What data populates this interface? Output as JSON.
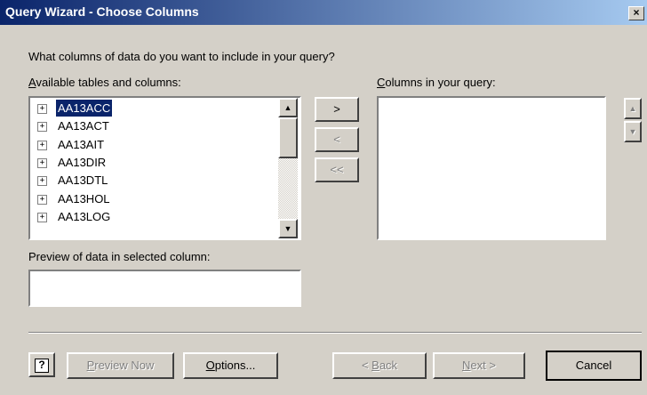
{
  "window": {
    "title": "Query Wizard - Choose Columns",
    "close_label": "×"
  },
  "prompt": "What columns of data do you want to include in your query?",
  "available": {
    "label_prefix": "A",
    "label_rest": "vailable tables and columns:",
    "items": [
      {
        "expander": "+",
        "label": "AA13ACC",
        "selected": true
      },
      {
        "expander": "+",
        "label": "AA13ACT"
      },
      {
        "expander": "+",
        "label": "AA13AIT"
      },
      {
        "expander": "+",
        "label": "AA13DIR"
      },
      {
        "expander": "+",
        "label": "AA13DTL"
      },
      {
        "expander": "+",
        "label": "AA13HOL"
      },
      {
        "expander": "+",
        "label": "AA13LOG"
      }
    ],
    "scroll_up": "▲",
    "scroll_down": "▼"
  },
  "move_buttons": {
    "add": ">",
    "remove": "<",
    "remove_all": "<<"
  },
  "query_columns": {
    "label_prefix": "C",
    "label_rest": "olumns in your query:",
    "order_up": "▲",
    "order_down": "▼"
  },
  "preview": {
    "label": "Preview of data in selected column:",
    "value": ""
  },
  "footer": {
    "help_label": "?",
    "preview_now_prefix": "P",
    "preview_now_rest": "review Now",
    "options_prefix": "O",
    "options_rest": "ptions...",
    "back_lead": "< ",
    "back_prefix": "B",
    "back_rest": "ack",
    "next_prefix": "N",
    "next_rest": "ext >",
    "cancel": "Cancel"
  }
}
